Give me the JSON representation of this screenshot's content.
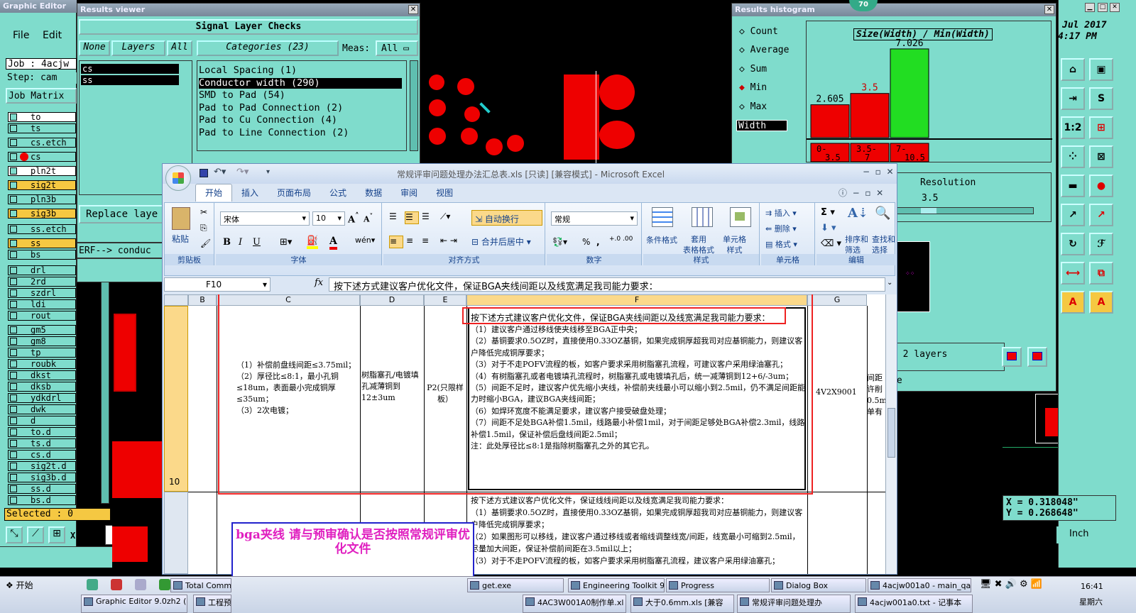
{
  "graphic_editor": {
    "title": "Graphic Editor",
    "menu": [
      "File",
      "Edit"
    ],
    "job_label": "Job : 4acjw",
    "step_label": "Step: cam",
    "job_matrix": "Job Matrix",
    "selected": "Selected : 0",
    "xy_label": "X Y :"
  },
  "layers": [
    "to",
    "ts",
    "cs.etch",
    "cs",
    "pln2t",
    "sig2t",
    "pln3b",
    "sig3b",
    "ss.etch",
    "ss",
    "bs",
    "drl",
    "2rd",
    "szdrl",
    "ldi",
    "rout",
    "gm5",
    "gm8",
    "tp",
    "roubk",
    "dkst",
    "dksb",
    "ydkdrl",
    "dwk",
    "d",
    "to.d",
    "ts.d",
    "cs.d",
    "sig2t.d",
    "sig3b.d",
    "ss.d",
    "bs.d"
  ],
  "results_viewer": {
    "title": "Results viewer",
    "heading": "Signal Layer Checks",
    "none": "None",
    "layers_btn": "Layers",
    "all": "All",
    "categories": "Categories (23)",
    "meas": "Meas:",
    "meas_val": "All",
    "layer_list": [
      "cs",
      "ss"
    ],
    "category_items": [
      "Local Spacing (1)",
      "Conductor width (290)",
      "SMD to Pad (54)",
      "Pad to Pad Connection (2)",
      "Pad to Cu Connection (4)",
      "Pad to Line Connection (2)"
    ],
    "replace": "Replace laye",
    "erf": "ERF--> conduc"
  },
  "histogram": {
    "title": "Results histogram",
    "badge": "70",
    "options": [
      "Count",
      "Average",
      "Sum",
      "Min",
      "Max"
    ],
    "field": "Width",
    "chart_title": "Size(Width) / Min(Width)",
    "bar_labels": [
      "2.605",
      "3.5",
      "7.026"
    ],
    "bins": [
      "0-\n3.5",
      "3.5-\n7",
      "7-\n10.5"
    ],
    "resolution_label": "Resolution",
    "resolution_val": "3.5",
    "footer": "r 2 layers",
    "footer2": "se"
  },
  "clock": {
    "date": "Jul 2017",
    "time": "4:17 PM"
  },
  "coords": {
    "x": "X = 0.318048\"",
    "y": "Y = 0.268648\"",
    "unit": "Inch"
  },
  "excel": {
    "title": "常规评审问题处理办法汇总表.xls  [只读]  [兼容模式] - Microsoft Excel",
    "tabs": [
      "开始",
      "插入",
      "页面布局",
      "公式",
      "数据",
      "审阅",
      "视图"
    ],
    "font": "宋体",
    "size": "10",
    "wrap": "自动换行",
    "merge": "合并后居中",
    "numfmt": "常规",
    "groups": [
      "剪贴板",
      "字体",
      "对齐方式",
      "数字",
      "样式",
      "单元格",
      "编辑"
    ],
    "btns": {
      "paste": "粘贴",
      "cond": "条件格式",
      "table": "套用\n表格格式",
      "cellstyle": "单元格\n样式",
      "insert": "插入",
      "delete": "删除",
      "format": "格式",
      "sort": "排序和\n筛选",
      "find": "查找和\n选择"
    },
    "namebox": "F10",
    "fx": "fx",
    "formula": "按下述方式建议客户优化文件，保证BGA夹线间距以及线宽满足我司能力要求：",
    "cols": [
      "B",
      "C",
      "D",
      "E",
      "F",
      "G"
    ],
    "row_num": "10",
    "c10": "（1）补偿前盘线间距≤3.75mil；\n（2）厚径比≤8:1，最小孔铜≤18um，表面最小完成铜厚≤35um；\n（3）2次电镀；",
    "d10": "树脂塞孔/电镀填孔减薄铜到12±3um",
    "e10": "P2(只限样板）",
    "f10_head": "按下述方式建议客户优化文件，保证BGA夹线间距以及线宽满足我司能力要求：",
    "f10": "（1）建议客户通过移线使夹线移至BGA正中央；\n（2）基铜要求0.5OZ时，直接使用0.33OZ基铜，如果完成铜厚超我司对应基铜能力，则建议客户降低完成铜厚要求；\n（3）对于不走POFV流程的板，如客户要求采用树脂塞孔流程，可建议客户采用绿油塞孔；\n（4）有树脂塞孔或者电镀填孔流程时，树脂塞孔或电镀填孔后，统一减薄铜到12+6/-3um；\n（5）间距不足时，建议客户优先缩小夹线，补偿前夹线最小可以缩小到2.5mil，仍不满足间距能力时缩小BGA，建议BGA夹线间距；\n（6）如焊环宽度不能满足要求，建议客户接受破盘处理；\n（7）间距不足处BGA补偿1.5mil，线路最小补偿1mil，对于间距足够处BGA补偿2.3mil，线路补偿1.5mil，保证补偿后盘线间距2.5mil；\n注：此处厚径比≤8:1是指除树脂塞孔之外的其它孔。",
    "g10": "4V2X9001",
    "h10": "间距\n许削\n0.5m\n单有",
    "f11": "按下述方式建议客户优化文件，保证线线间距以及线宽满足我司能力要求：\n（1）基铜要求0.5OZ时，直接使用0.33OZ基铜，如果完成铜厚超我司对应基铜能力，则建议客户降低完成铜厚要求；\n（2）如果图形可以移线，建议客户通过移线或者缩线调整线宽/间距，线宽最小可缩到2.5mil，尽量加大间距，保证补偿前间距在3.5mil以上；\n（3）对于不走POFV流程的板，如客户要求采用树脂塞孔流程，建议客户采用绿油塞孔；"
  },
  "note": "bga夹线  请与预审确认是否按照常规评审优化文件",
  "taskbar": {
    "start": "开始",
    "row1": [
      "Total Comm",
      "get.exe",
      "Engineering Toolkit 9...",
      "Progress",
      "Dialog Box",
      "4acjw001a0 - main_qa"
    ],
    "row2": [
      "Graphic Editor 9.0zh2 (0...",
      "工程预",
      "4AC3W001A0制作单.xl",
      "大于0.6mm.xls [兼容",
      "常规评审问题处理办",
      "4acjw001a0.txt - 记事本"
    ],
    "clock": "16:41",
    "day": "星期六"
  }
}
